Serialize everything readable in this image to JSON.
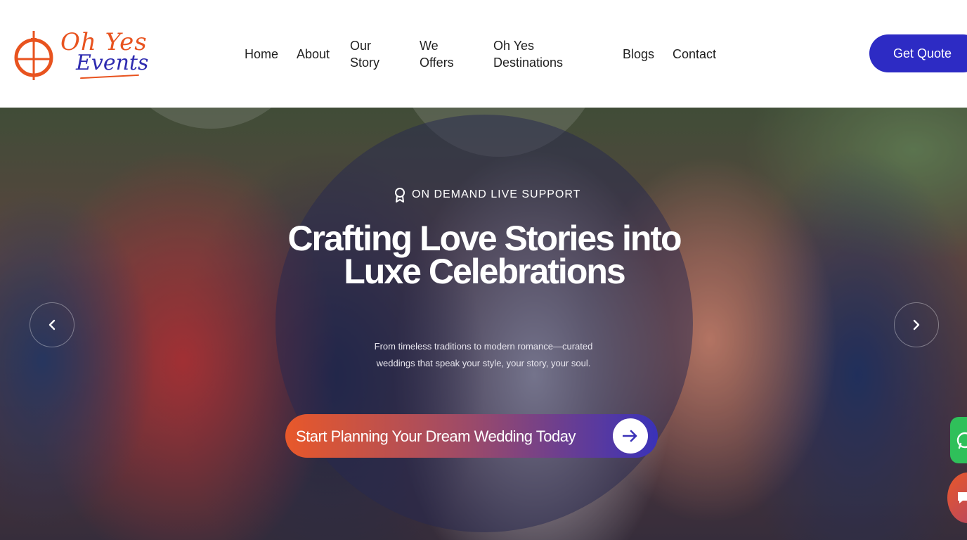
{
  "brand": {
    "name_line1": "Oh Yes",
    "name_line2": "Events"
  },
  "nav": {
    "home": "Home",
    "about": "About",
    "our_story": "Our Story",
    "we_offers": "We Offers",
    "destinations": "Oh Yes Destinations",
    "blogs": "Blogs",
    "contact": "Contact"
  },
  "header": {
    "cta_label": "Get Quote"
  },
  "hero": {
    "eyebrow": "ON DEMAND LIVE SUPPORT",
    "title": "Crafting Love Stories into Luxe Celebrations",
    "subtitle": "From timeless traditions to modern romance—curated weddings that speak your style, your story, your soul.",
    "cta_label": "Start Planning Your Dream Wedding Today"
  },
  "icons": {
    "eyebrow": "award-ribbon-icon",
    "cta": "arrow-right-icon",
    "prev": "chevron-left-icon",
    "next": "chevron-right-icon",
    "whatsapp": "whatsapp-icon",
    "chat": "chat-bubble-icon"
  },
  "colors": {
    "brand_orange": "#e8531f",
    "brand_blue": "#2d2bc4",
    "text_dark": "#1f1f1f",
    "whatsapp_green": "#2fc05a"
  }
}
